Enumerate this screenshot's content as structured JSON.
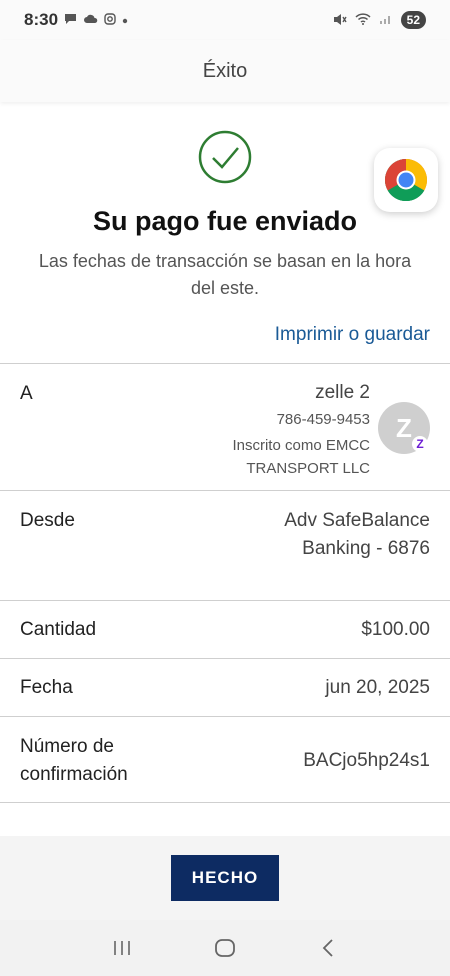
{
  "status_bar": {
    "time": "8:30",
    "battery": "52",
    "icons": [
      "chat-icon",
      "cloud-icon",
      "instagram-icon",
      "dot-icon",
      "mute-icon",
      "wifi-icon",
      "signal-icon"
    ]
  },
  "header": {
    "title": "Éxito"
  },
  "success": {
    "title": "Su pago fue enviado",
    "subtitle": "Las fechas de transacción se basan en la hora del este.",
    "print_link": "Imprimir o guardar",
    "icon": "check-circle-icon",
    "accent": "#2e7d32"
  },
  "details": {
    "to": {
      "label": "A",
      "name": "zelle 2",
      "phone": "786-459-9453",
      "enrolled": "Inscrito como EMCC TRANSPORT LLC",
      "avatar_letter": "Z",
      "badge": "Z"
    },
    "from": {
      "label": "Desde",
      "value": "Adv SafeBalance Banking - 6876"
    },
    "amount": {
      "label": "Cantidad",
      "value": "$100.00"
    },
    "date": {
      "label": "Fecha",
      "value": "jun 20, 2025"
    },
    "confirmation": {
      "label": "Número de confirmación",
      "value": "BACjo5hp24s1"
    }
  },
  "footer": {
    "done_label": "HECHO",
    "button_color": "#0d2b62"
  },
  "link_color": "#1a5a96",
  "nav": [
    "recents-icon",
    "home-icon",
    "back-icon"
  ]
}
